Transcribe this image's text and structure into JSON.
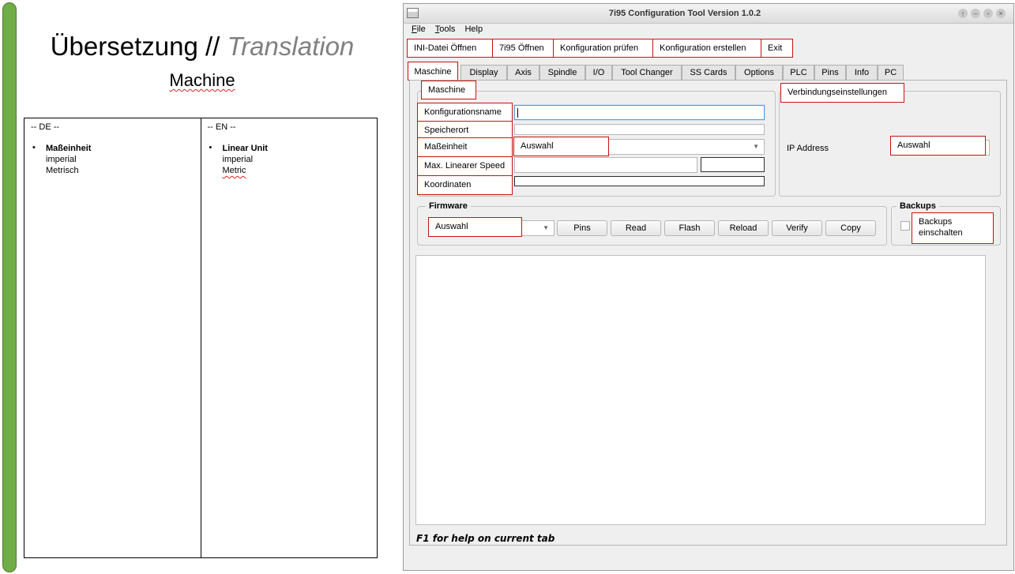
{
  "doc": {
    "title_main": "Übersetzung // ",
    "title_trans": "Translation",
    "subtitle": "Machine",
    "col_de": {
      "header": "-- DE --",
      "term": "Maßeinheit",
      "opt1": "imperial",
      "opt2": "Metrisch"
    },
    "col_en": {
      "header": "-- EN --",
      "term": "Linear Unit",
      "opt1": "imperial",
      "opt2": "Metric"
    }
  },
  "window": {
    "title": "7i95 Configuration Tool Version 1.0.2",
    "controls": [
      "↑",
      "–",
      "▫",
      "×"
    ]
  },
  "menu": [
    "File",
    "Tools",
    "Help"
  ],
  "toolbar": [
    "INI-Datei Öffnen",
    "7i95 Öffnen",
    "Konfiguration prüfen",
    "Konfiguration erstellen",
    "Exit"
  ],
  "tabs": [
    "Maschine",
    "Display",
    "Axis",
    "Spindle",
    "I/O",
    "Tool Changer",
    "SS Cards",
    "Options",
    "PLC",
    "Pins",
    "Info",
    "PC"
  ],
  "machine_group": {
    "title": "Maschine",
    "labels": [
      "Konfigurationsname",
      "Speicherort",
      "Maßeinheit",
      "Max. Linearer Speed",
      "Koordinaten"
    ],
    "unit_select": "Auswahl"
  },
  "connection_group": {
    "title": "Verbindungseinstellungen",
    "ip_label": "IP Address",
    "ip_select": "Auswahl"
  },
  "firmware_group": {
    "title": "Firmware",
    "select": "Auswahl",
    "buttons": [
      "Pins",
      "Read",
      "Flash",
      "Reload",
      "Verify",
      "Copy"
    ]
  },
  "backups_group": {
    "title": "Backups",
    "checkbox_label": "Backups einschalten"
  },
  "help_text": "F1 for help on current tab"
}
